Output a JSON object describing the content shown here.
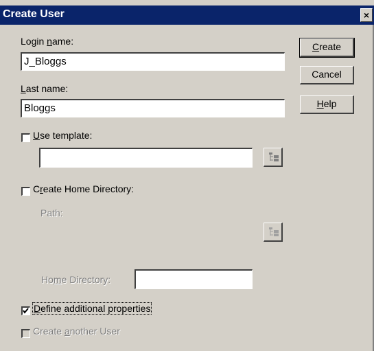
{
  "dialog": {
    "title": "Create User",
    "close_label": "×"
  },
  "login": {
    "label_prefix": "Login ",
    "label_mnemonic": "n",
    "label_suffix": "ame:",
    "value": "J_Bloggs"
  },
  "lastname": {
    "label_mnemonic": "L",
    "label_suffix": "ast name:",
    "value": "Bloggs"
  },
  "template": {
    "checked": false,
    "label_mnemonic": "U",
    "label_suffix": "se template:",
    "value": ""
  },
  "home": {
    "checked": false,
    "label_prefix": "C",
    "label_mnemonic": "r",
    "label_suffix": "eate Home Directory:",
    "path_label": "Path:",
    "homedir_prefix": "Ho",
    "homedir_mnemonic": "m",
    "homedir_suffix": "e Directory:",
    "homedir_value": ""
  },
  "additional": {
    "checked": true,
    "label_mnemonic": "D",
    "label_suffix": "efine additional properties"
  },
  "another": {
    "checked": false,
    "label_prefix": "Create ",
    "label_mnemonic": "a",
    "label_suffix": "nother User"
  },
  "buttons": {
    "create_mnemonic": "C",
    "create_suffix": "reate",
    "cancel": "Cancel",
    "help_mnemonic": "H",
    "help_suffix": "elp"
  },
  "icons": {
    "browse": "tree-browse-icon",
    "check": "checkmark-icon"
  }
}
